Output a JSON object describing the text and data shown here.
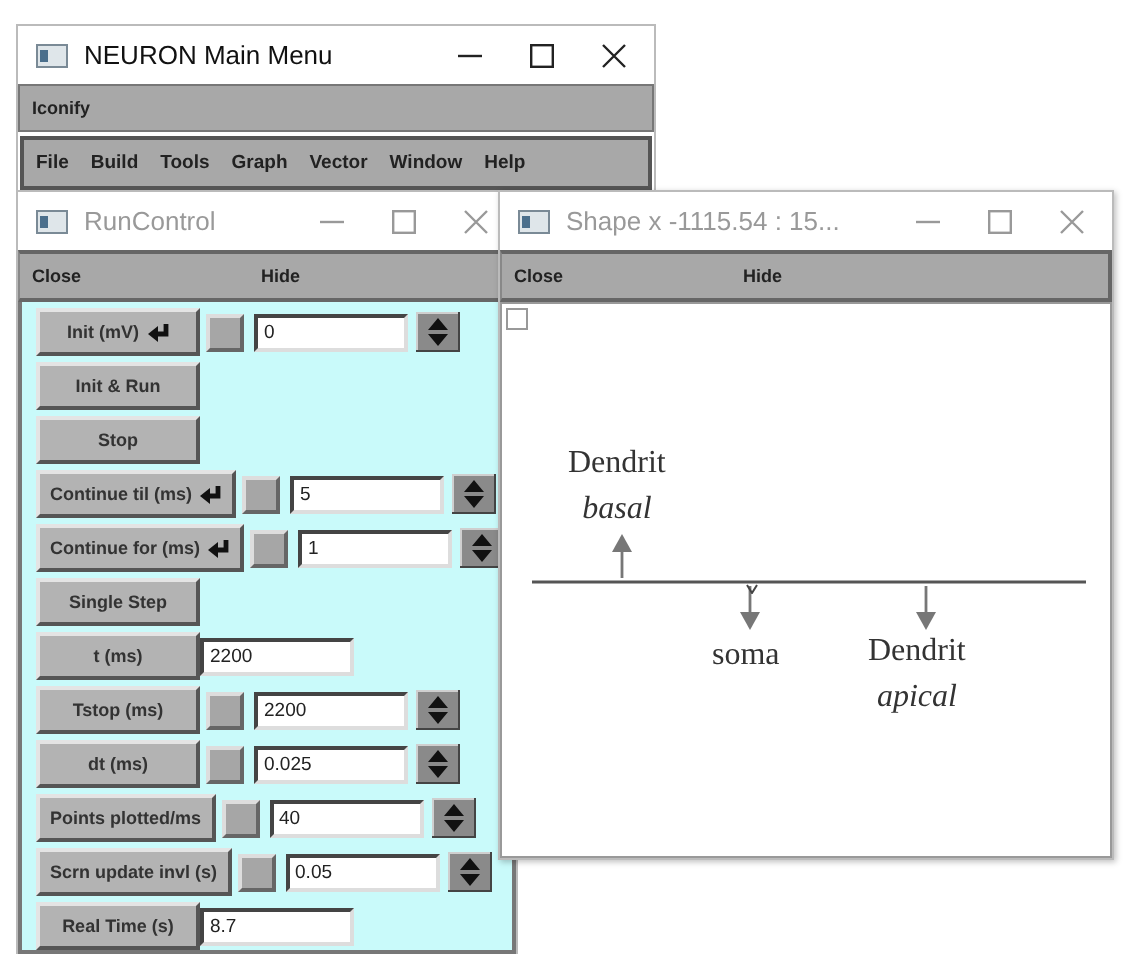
{
  "main_menu": {
    "title": "NEURON Main Menu",
    "active": true,
    "toolbar": [
      "Iconify"
    ],
    "menu": [
      "File",
      "Build",
      "Tools",
      "Graph",
      "Vector",
      "Window",
      "Help"
    ]
  },
  "run_control": {
    "title": "RunControl",
    "active": false,
    "toolbar": [
      "Close",
      "Hide"
    ],
    "rows": [
      {
        "kind": "field",
        "label": "Init (mV)",
        "enter": true,
        "checked": false,
        "value": "0"
      },
      {
        "kind": "button",
        "label": "Init & Run"
      },
      {
        "kind": "button",
        "label": "Stop"
      },
      {
        "kind": "field",
        "label": "Continue til (ms)",
        "enter": true,
        "checked": false,
        "value": "5"
      },
      {
        "kind": "field",
        "label": "Continue for (ms)",
        "enter": true,
        "checked": false,
        "value": "1"
      },
      {
        "kind": "button",
        "label": "Single Step"
      },
      {
        "kind": "readout",
        "label": "t (ms)",
        "value": "2200"
      },
      {
        "kind": "field",
        "label": "Tstop (ms)",
        "enter": false,
        "checked": false,
        "value": "2200"
      },
      {
        "kind": "field",
        "label": "dt (ms)",
        "enter": false,
        "checked": false,
        "value": "0.025"
      },
      {
        "kind": "field",
        "label": "Points plotted/ms",
        "enter": false,
        "checked": false,
        "value": "40"
      },
      {
        "kind": "field",
        "label": "Scrn update invl (s)",
        "enter": false,
        "checked": false,
        "value": "0.05"
      },
      {
        "kind": "readout",
        "label": "Real Time (s)",
        "value": "8.7"
      }
    ]
  },
  "shape": {
    "title": "Shape x -1115.54 : 15...",
    "active": false,
    "toolbar": [
      "Close",
      "Hide"
    ],
    "annotations": [
      {
        "kind": "up_arrow",
        "name": "Dendrit",
        "qualifier": "basal"
      },
      {
        "kind": "down_arrow",
        "name": "soma"
      },
      {
        "kind": "down_arrow",
        "name": "Dendrit",
        "qualifier": "apical"
      }
    ]
  }
}
